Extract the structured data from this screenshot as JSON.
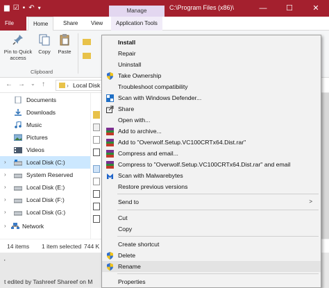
{
  "titlebar": {
    "manage_tab": "Manage",
    "path": "C:\\Program Files (x86)\\",
    "minimize": "—",
    "maximize": "☐",
    "close": "✕",
    "qat_icons": [
      "folder-icon",
      "properties-icon",
      "new-folder-icon",
      "undo-icon"
    ]
  },
  "ribbon": {
    "tabs": [
      "File",
      "Home",
      "Share",
      "View",
      "Application Tools"
    ],
    "pin_label": "Pin to Quick access",
    "copy_label": "Copy",
    "paste_label": "Paste",
    "group_label": "Clipboard"
  },
  "address": {
    "back": "←",
    "forward": "→",
    "recent": "⌄",
    "up": "↑",
    "path": "Local Disk"
  },
  "navpane": {
    "items": [
      {
        "label": "Documents",
        "icon": "documents-icon"
      },
      {
        "label": "Downloads",
        "icon": "downloads-icon"
      },
      {
        "label": "Music",
        "icon": "music-icon"
      },
      {
        "label": "Pictures",
        "icon": "pictures-icon"
      },
      {
        "label": "Videos",
        "icon": "videos-icon"
      },
      {
        "label": "Local Disk (C:)",
        "icon": "drive-icon",
        "selected": true
      },
      {
        "label": "System Reserved",
        "icon": "drive-icon"
      },
      {
        "label": "Local Disk (E:)",
        "icon": "drive-icon"
      },
      {
        "label": "Local Disk (F:)",
        "icon": "drive-icon"
      },
      {
        "label": "Local Disk (G:)",
        "icon": "drive-icon"
      },
      {
        "label": "Network",
        "icon": "network-icon"
      }
    ]
  },
  "status": {
    "items": "14 items",
    "selected": "1 item selected",
    "size": "744 K"
  },
  "below": {
    "line1": "'",
    "line2": "t edited by Tashreef Shareef on M"
  },
  "context_menu": {
    "items": [
      {
        "label": "Install",
        "bold": true
      },
      {
        "label": "Repair"
      },
      {
        "label": "Uninstall"
      },
      {
        "label": "Take Ownership",
        "icon": "uac-shield-icon"
      },
      {
        "label": "Troubleshoot compatibility"
      },
      {
        "label": "Scan with Windows Defender...",
        "icon": "windows-defender-icon"
      },
      {
        "label": "Share",
        "icon": "share-icon"
      },
      {
        "label": "Open with..."
      },
      {
        "label": "Add to archive...",
        "icon": "winrar-icon"
      },
      {
        "label": "Add to \"Overwolf.Setup.VC100CRTx64.Dist.rar\"",
        "icon": "winrar-icon"
      },
      {
        "label": "Compress and email...",
        "icon": "winrar-icon"
      },
      {
        "label": "Compress to \"Overwolf.Setup.VC100CRTx64.Dist.rar\" and email",
        "icon": "winrar-icon"
      },
      {
        "label": "Scan with Malwarebytes",
        "icon": "malwarebytes-icon"
      },
      {
        "label": "Restore previous versions"
      },
      {
        "label": "Send to",
        "submenu": true
      },
      {
        "label": "Cut"
      },
      {
        "label": "Copy"
      },
      {
        "label": "Create shortcut"
      },
      {
        "label": "Delete",
        "icon": "uac-shield-icon"
      },
      {
        "label": "Rename",
        "icon": "uac-shield-icon",
        "hover": true
      },
      {
        "label": "Properties"
      }
    ],
    "submenu_arrow": ">"
  }
}
